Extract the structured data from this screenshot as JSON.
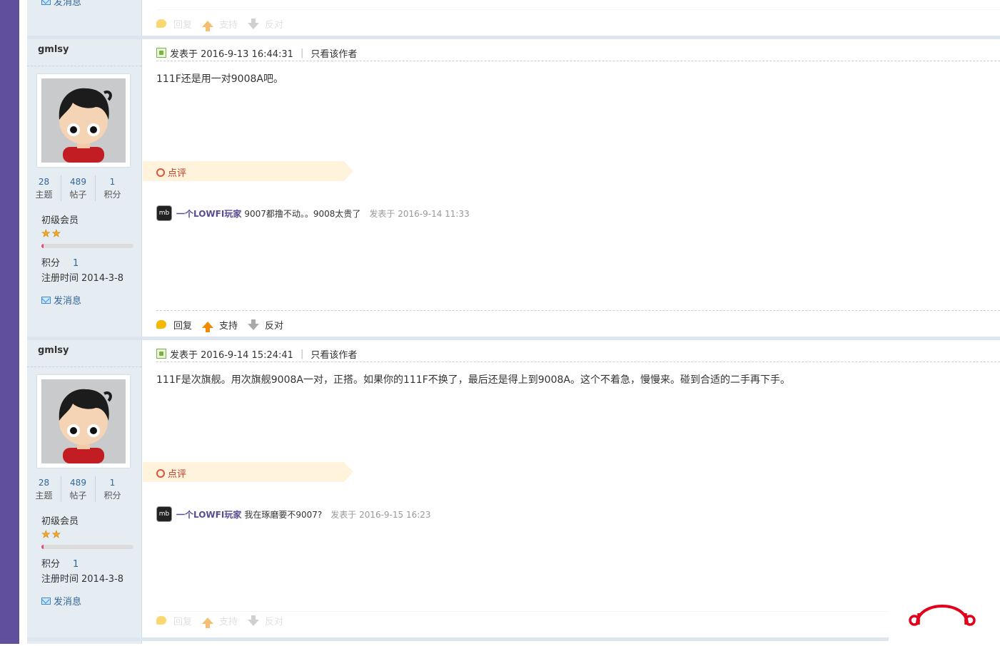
{
  "colors": {
    "brand_purple": "#5f4f9c",
    "sidebar_bg": "#e5edf2",
    "comment_tag_bg": "#fff3dc",
    "comment_red": "#c0392b",
    "link_blue": "#336699",
    "logo_red": "#e1001a"
  },
  "top_partial": {
    "msg_label": "发消息",
    "actions": {
      "reply": "回复",
      "support": "支持",
      "oppose": "反对"
    }
  },
  "posts": [
    {
      "user": {
        "name": "gmlsy",
        "stats": [
          {
            "num": "28",
            "label": "主题"
          },
          {
            "num": "489",
            "label": "帖子"
          },
          {
            "num": "1",
            "label": "积分"
          }
        ],
        "level": "初级会员",
        "level_progress": 0.02,
        "points_label": "积分",
        "points_value": "1",
        "reg_label": "注册时间",
        "reg_value": "2014-3-8",
        "msg_label": "发消息"
      },
      "posted_label": "发表于 2016-9-13 16:44:31",
      "only_author": "只看该作者",
      "content": "111F还是用一对9008A吧。",
      "comment_tag": "点评",
      "comment": {
        "avatar_text": "mb",
        "user": "一个LOWFI玩家",
        "text": "9007都撸不动。。9008太贵了",
        "time": "发表于 2016-9-14 11:33"
      },
      "actions": {
        "reply": "回复",
        "support": "支持",
        "oppose": "反对"
      }
    },
    {
      "user": {
        "name": "gmlsy",
        "stats": [
          {
            "num": "28",
            "label": "主题"
          },
          {
            "num": "489",
            "label": "帖子"
          },
          {
            "num": "1",
            "label": "积分"
          }
        ],
        "level": "初级会员",
        "level_progress": 0.02,
        "points_label": "积分",
        "points_value": "1",
        "reg_label": "注册时间",
        "reg_value": "2014-3-8",
        "msg_label": "发消息"
      },
      "posted_label": "发表于 2016-9-14 15:24:41",
      "only_author": "只看该作者",
      "content": "111F是次旗舰。用次旗舰9008A一对，正搭。如果你的111F不换了，最后还是得上到9008A。这个不着急，慢慢来。碰到合适的二手再下手。",
      "comment_tag": "点评",
      "comment": {
        "avatar_text": "mb",
        "user": "一个LOWFI玩家",
        "text": "我在琢磨要不9007?",
        "time": "发表于 2016-9-15 16:23"
      },
      "actions": {
        "reply": "回复",
        "support": "支持",
        "oppose": "反对"
      }
    }
  ]
}
